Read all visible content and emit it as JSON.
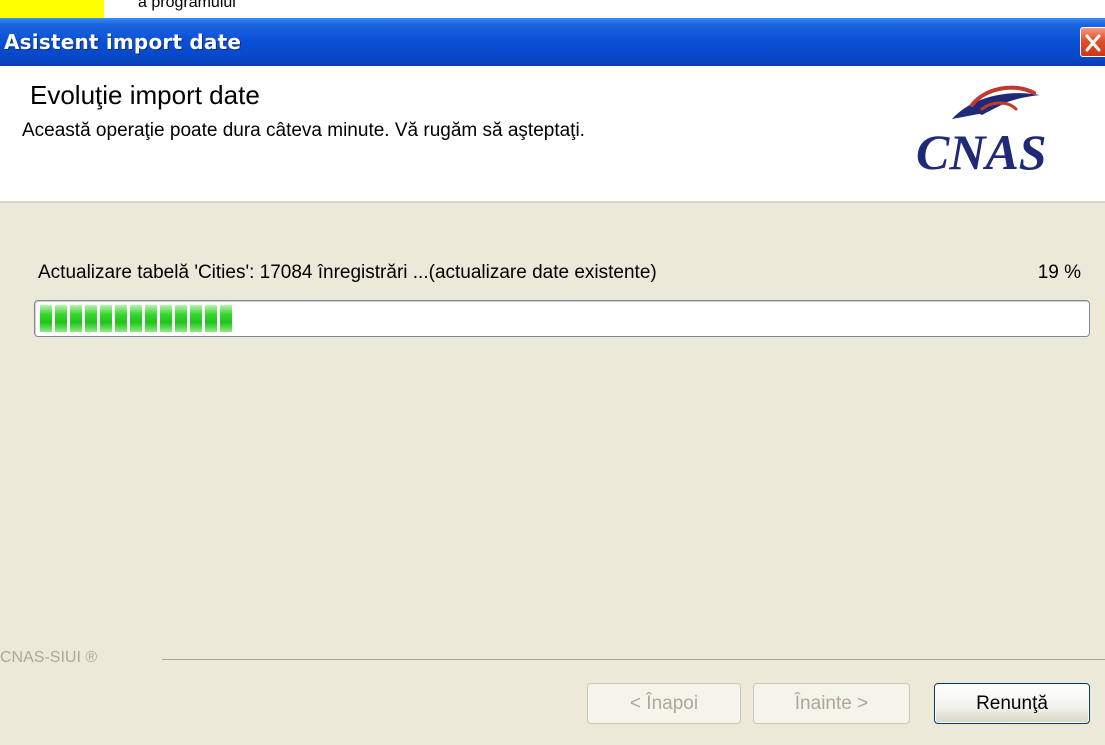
{
  "top_strip": {
    "text": "a programului"
  },
  "window": {
    "title": "Asistent import date"
  },
  "header": {
    "title": "Evoluţie import date",
    "subtitle": "Această operaţie poate dura câteva minute. Vă rugăm să aşteptaţi.",
    "logo_text": "CNAS"
  },
  "progress": {
    "status": "Actualizare tabelă 'Cities': 17084 înregistrări ...(actualizare date existente)",
    "percent_label": "19 %",
    "value": 0.19
  },
  "footer": {
    "brand": "CNAS-SIUI ®"
  },
  "buttons": {
    "back": "< Înapoi",
    "next": "Înainte >",
    "cancel": "Renunţă"
  },
  "colors": {
    "titlebar": "#0a4fd6",
    "progress_fill": "#21c41b",
    "logo": "#1e2a78",
    "logo_swoosh": "#c0392b"
  }
}
